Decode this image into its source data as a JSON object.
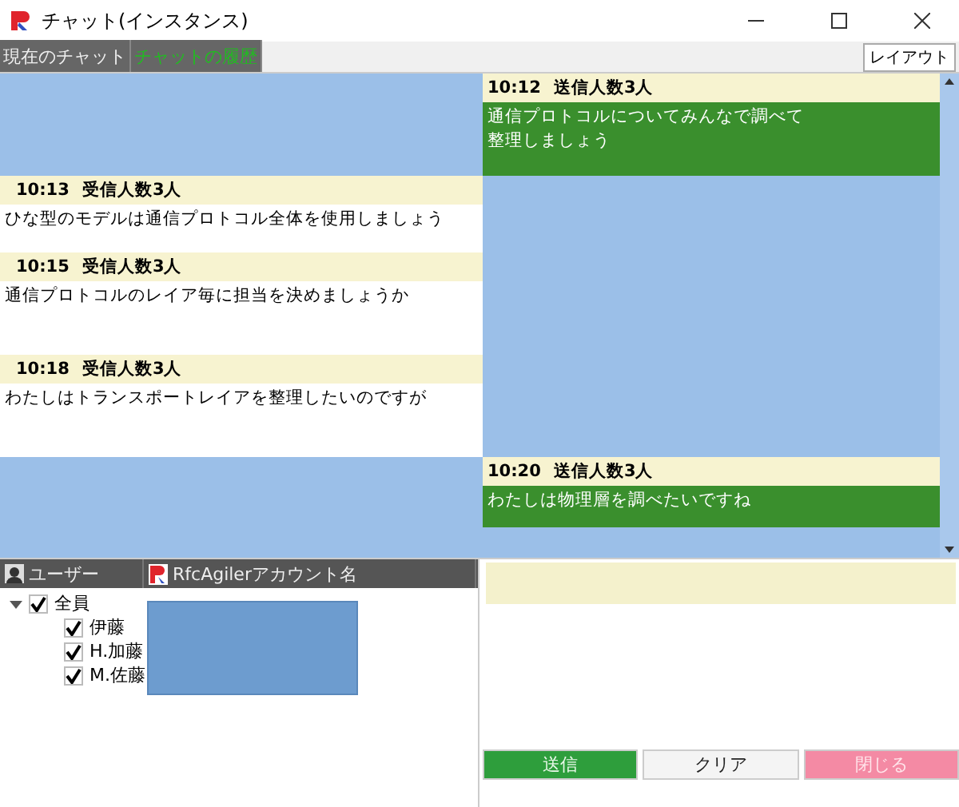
{
  "window": {
    "title": "チャット(インスタンス)"
  },
  "tabs": [
    {
      "label": "現在のチャット",
      "selected": false
    },
    {
      "label": "チャットの履歴",
      "selected": true
    }
  ],
  "layout_button": "レイアウト",
  "messages": [
    {
      "kind": "sent",
      "time": "10:12",
      "recipients": "送信人数3人",
      "lines": [
        "通信プロトコルについてみんなで調べて",
        "整理しましょう"
      ]
    },
    {
      "kind": "received",
      "time": "10:13",
      "recipients": "受信人数3人",
      "lines": [
        "ひな型のモデルは通信プロトコル全体を使用しましょう"
      ]
    },
    {
      "kind": "received",
      "time": "10:15",
      "recipients": "受信人数3人",
      "lines": [
        "通信プロトコルのレイア毎に担当を決めましょうか"
      ]
    },
    {
      "kind": "received",
      "time": "10:18",
      "recipients": "受信人数3人",
      "lines": [
        "わたしはトランスポートレイアを整理したいのですが"
      ]
    },
    {
      "kind": "sent",
      "time": "10:20",
      "recipients": "送信人数3人",
      "lines": [
        "わたしは物理層を調べたいですね"
      ]
    }
  ],
  "user_tree": {
    "columns": [
      "ユーザー",
      "RfcAgilerアカウント名"
    ],
    "items": [
      {
        "label": "全員",
        "checked": true,
        "expanded": true,
        "children": [
          {
            "label": "伊藤",
            "checked": true
          },
          {
            "label": "H.加藤",
            "checked": true
          },
          {
            "label": "M.佐藤",
            "checked": true
          }
        ]
      }
    ]
  },
  "buttons": [
    {
      "kind": "send",
      "label": "送信"
    },
    {
      "kind": "clear",
      "label": "クリア"
    },
    {
      "kind": "close",
      "label": "閉じる"
    }
  ]
}
